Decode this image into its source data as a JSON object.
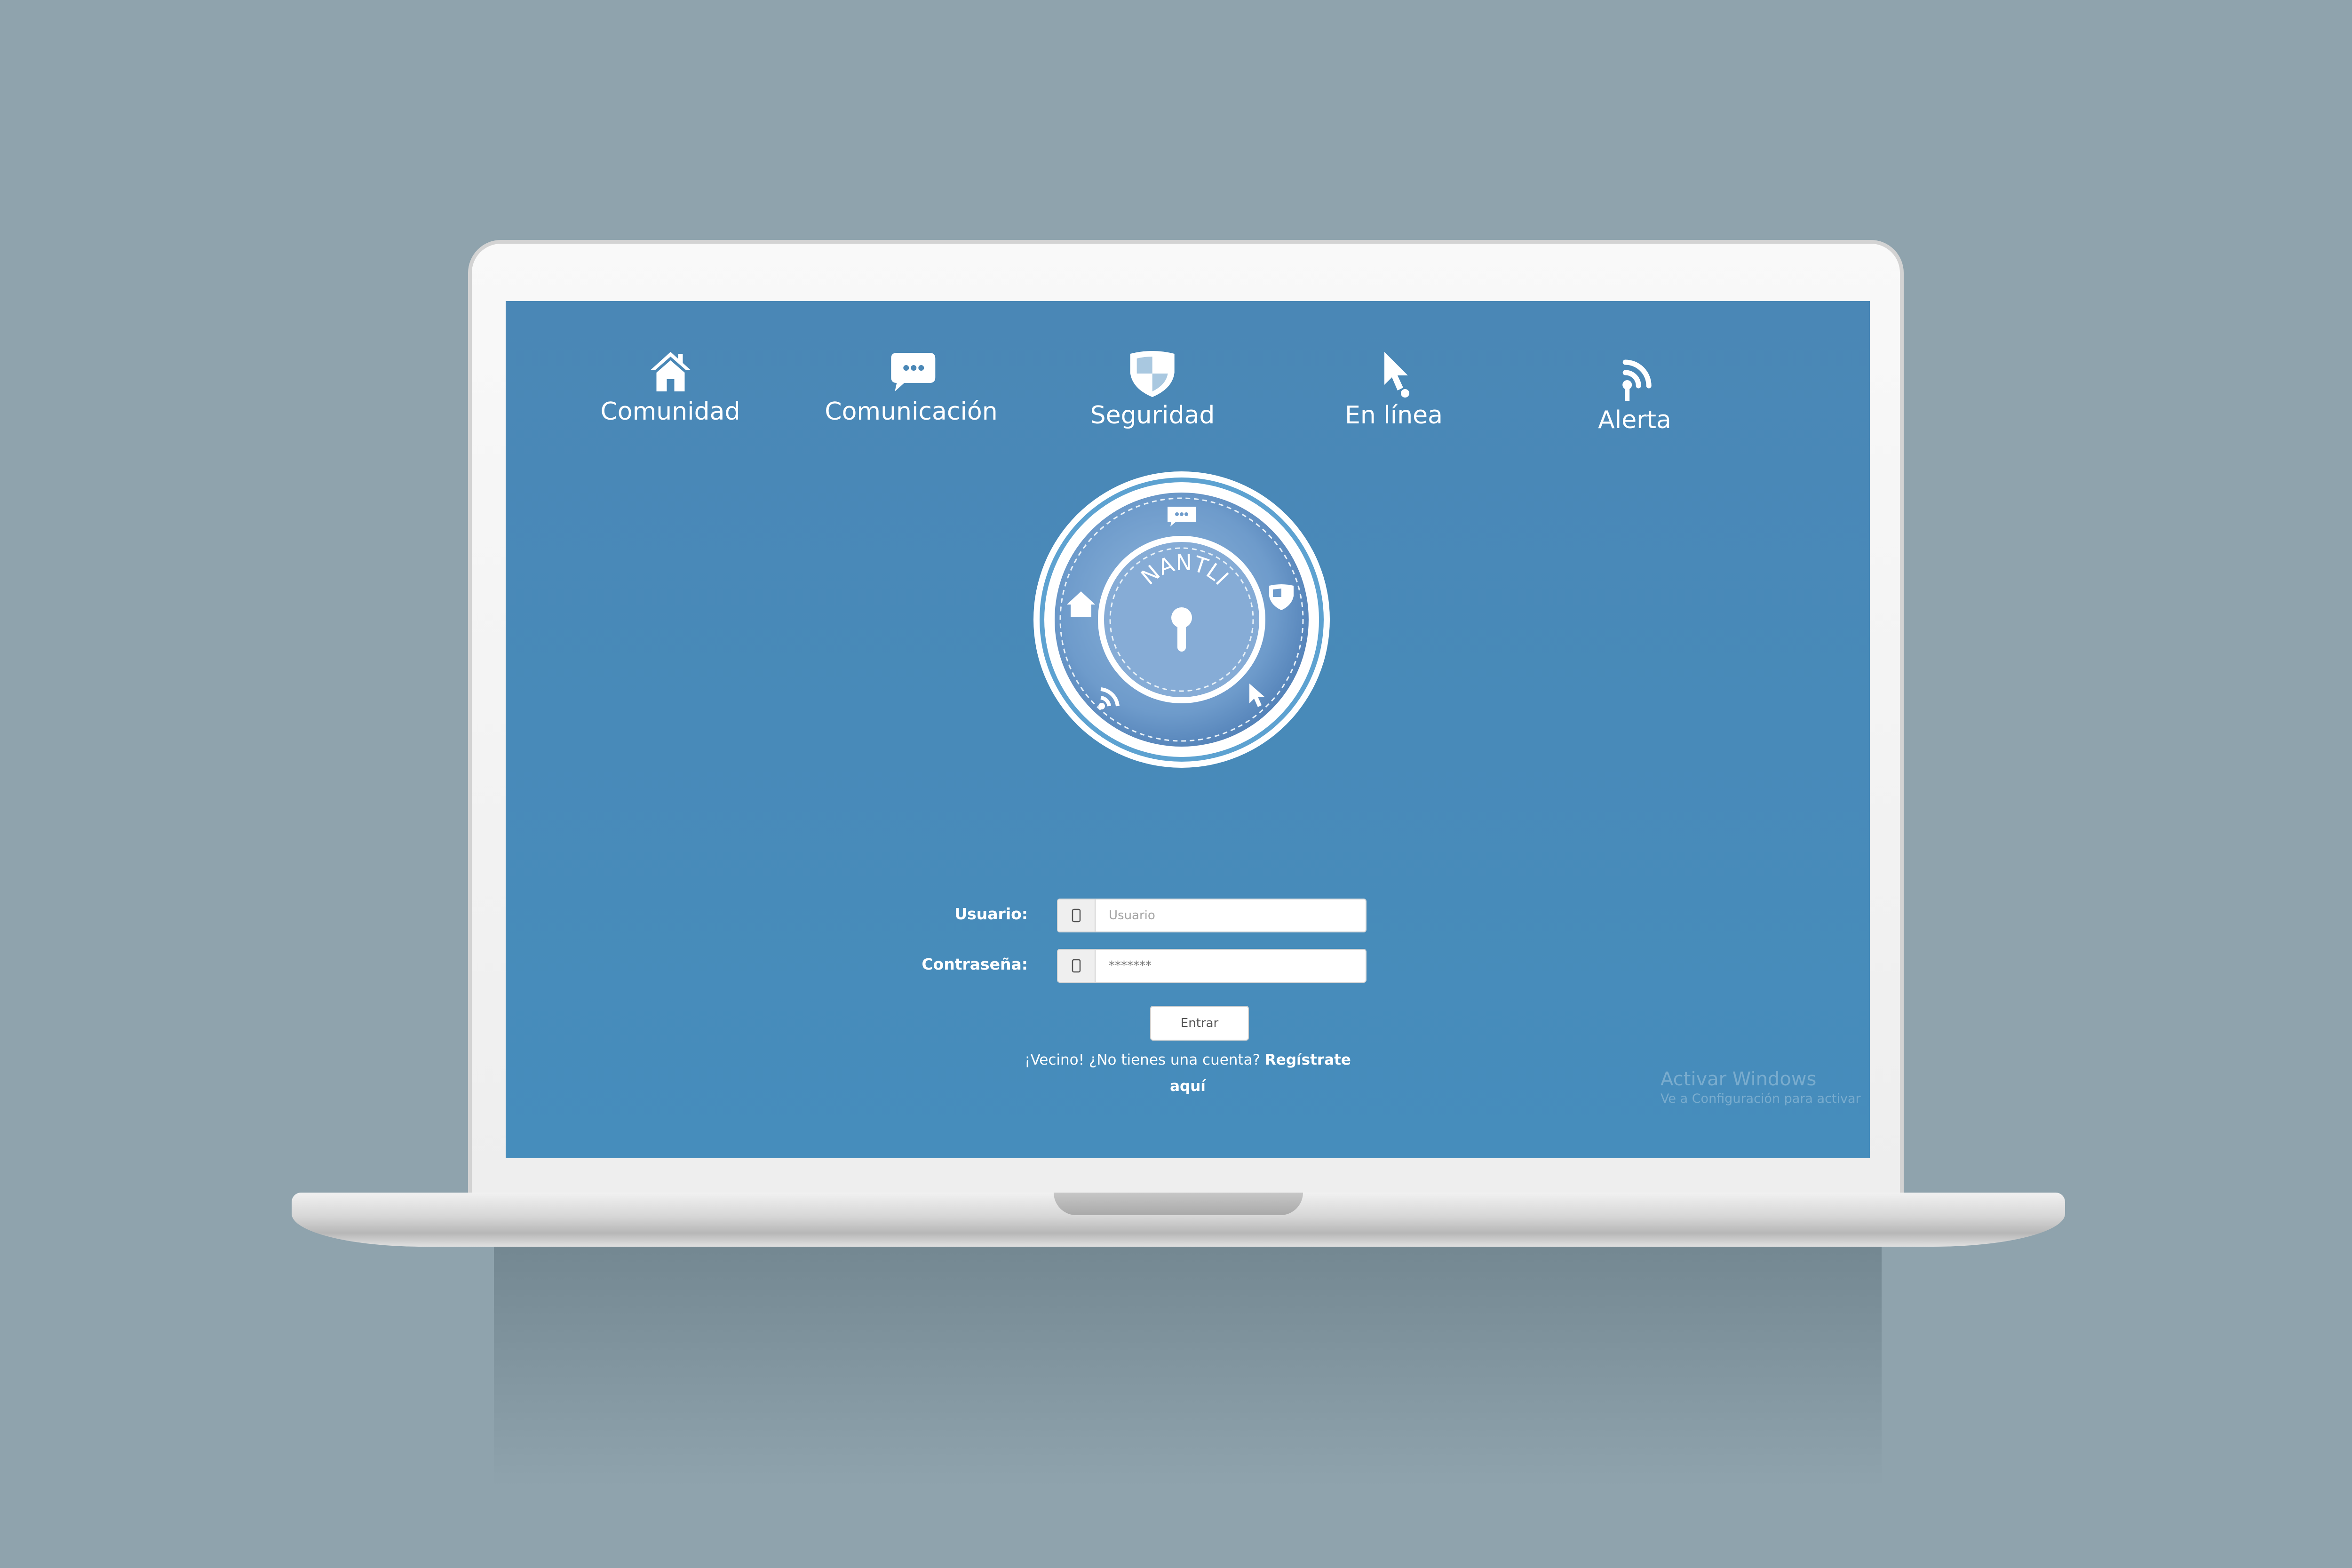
{
  "nav": {
    "items": [
      {
        "label": "Comunidad",
        "icon": "home-icon"
      },
      {
        "label": "Comunicación",
        "icon": "chat-icon"
      },
      {
        "label": "Seguridad",
        "icon": "shield-icon"
      },
      {
        "label": "En línea",
        "icon": "cursor-icon"
      },
      {
        "label": "Alerta",
        "icon": "wifi-signal-icon"
      }
    ]
  },
  "logo": {
    "text": "NANTLI"
  },
  "login": {
    "user_label": "Usuario:",
    "user_placeholder": "Usuario",
    "password_label": "Contraseña:",
    "password_value": "*******",
    "submit_label": "Entrar",
    "signup_text": "¡Vecino! ¿No tienes una cuenta?",
    "signup_link": "Regístrate aquí"
  },
  "watermark": {
    "title": "Activar Windows",
    "subtitle": "Ve a Configuración para activar"
  },
  "colors": {
    "page_background": "#8fa3ad",
    "screen_background": "#4a87b6",
    "text": "#ffffff"
  }
}
